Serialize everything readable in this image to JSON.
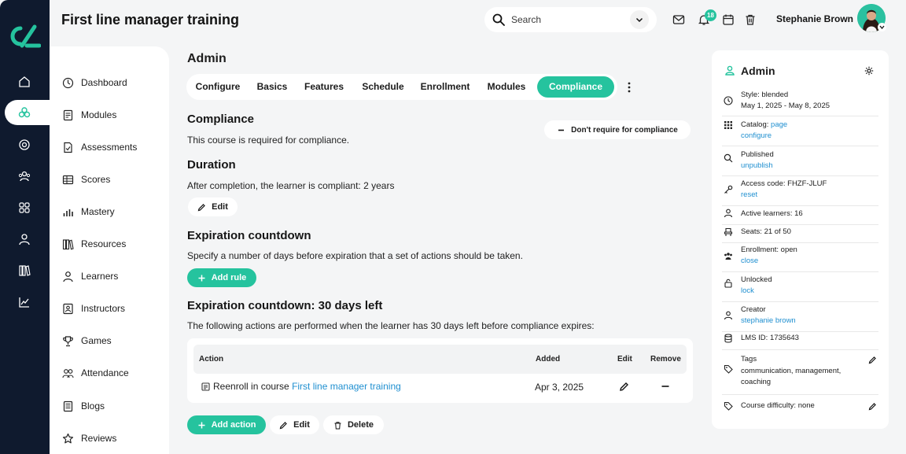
{
  "app": {
    "title": "First line manager training"
  },
  "header": {
    "search_placeholder": "Search",
    "notification_count": "18",
    "user_name": "Stephanie Brown"
  },
  "menu": {
    "items": [
      {
        "label": "Dashboard",
        "icon": "dashboard-icon"
      },
      {
        "label": "Modules",
        "icon": "modules-icon"
      },
      {
        "label": "Assessments",
        "icon": "assessments-icon"
      },
      {
        "label": "Scores",
        "icon": "scores-icon"
      },
      {
        "label": "Mastery",
        "icon": "mastery-icon"
      },
      {
        "label": "Resources",
        "icon": "resources-icon"
      },
      {
        "label": "Learners",
        "icon": "learners-icon"
      },
      {
        "label": "Instructors",
        "icon": "instructors-icon"
      },
      {
        "label": "Games",
        "icon": "trophy-icon"
      },
      {
        "label": "Attendance",
        "icon": "attendance-icon"
      },
      {
        "label": "Blogs",
        "icon": "blogs-icon"
      },
      {
        "label": "Reviews",
        "icon": "star-icon"
      }
    ]
  },
  "main": {
    "section_title": "Admin",
    "tabs": [
      "Configure",
      "Basics",
      "Features",
      "Schedule",
      "Enrollment",
      "Modules",
      "Compliance"
    ],
    "active_tab": "Compliance",
    "compliance": {
      "title": "Compliance",
      "text": "This course is required for compliance.",
      "toggle_label": "Don't require for compliance"
    },
    "duration": {
      "title": "Duration",
      "text": "After completion, the learner is compliant: 2 years",
      "edit_label": "Edit"
    },
    "expiration": {
      "title": "Expiration countdown",
      "text": "Specify a number of days before expiration that a set of actions should be taken.",
      "add_rule_label": "Add rule"
    },
    "countdown": {
      "title": "Expiration countdown: 30 days left",
      "text": "The following actions are performed when the learner has 30 days left before compliance expires:",
      "columns": {
        "action": "Action",
        "added": "Added",
        "edit": "Edit",
        "remove": "Remove"
      },
      "rows": [
        {
          "action_prefix": "Reenroll in course",
          "action_link": "First line manager training",
          "added": "Apr 3, 2025"
        }
      ],
      "add_action_label": "Add action",
      "edit_label": "Edit",
      "delete_label": "Delete"
    }
  },
  "panel": {
    "title": "Admin",
    "style": "Style: blended",
    "dates": "May 1, 2025 - May 8, 2025",
    "catalog_prefix": "Catalog:",
    "catalog_link": "page",
    "catalog_configure": "configure",
    "published": "Published",
    "unpublish": "unpublish",
    "access_code": "Access code: FHZF-JLUF",
    "reset": "reset",
    "active_learners": "Active learners: 16",
    "seats": "Seats: 21 of 50",
    "enrollment": "Enrollment: open",
    "close": "close",
    "unlocked": "Unlocked",
    "lock": "lock",
    "creator": "Creator",
    "creator_link": "stephanie brown",
    "lms_id": "LMS ID: 1735643",
    "tags_label": "Tags",
    "tags_value": "communication, management, coaching",
    "difficulty": "Course difficulty: none"
  },
  "colors": {
    "accent": "#25c39e",
    "rail": "#0f1a2e",
    "link": "#1f8fd0"
  }
}
